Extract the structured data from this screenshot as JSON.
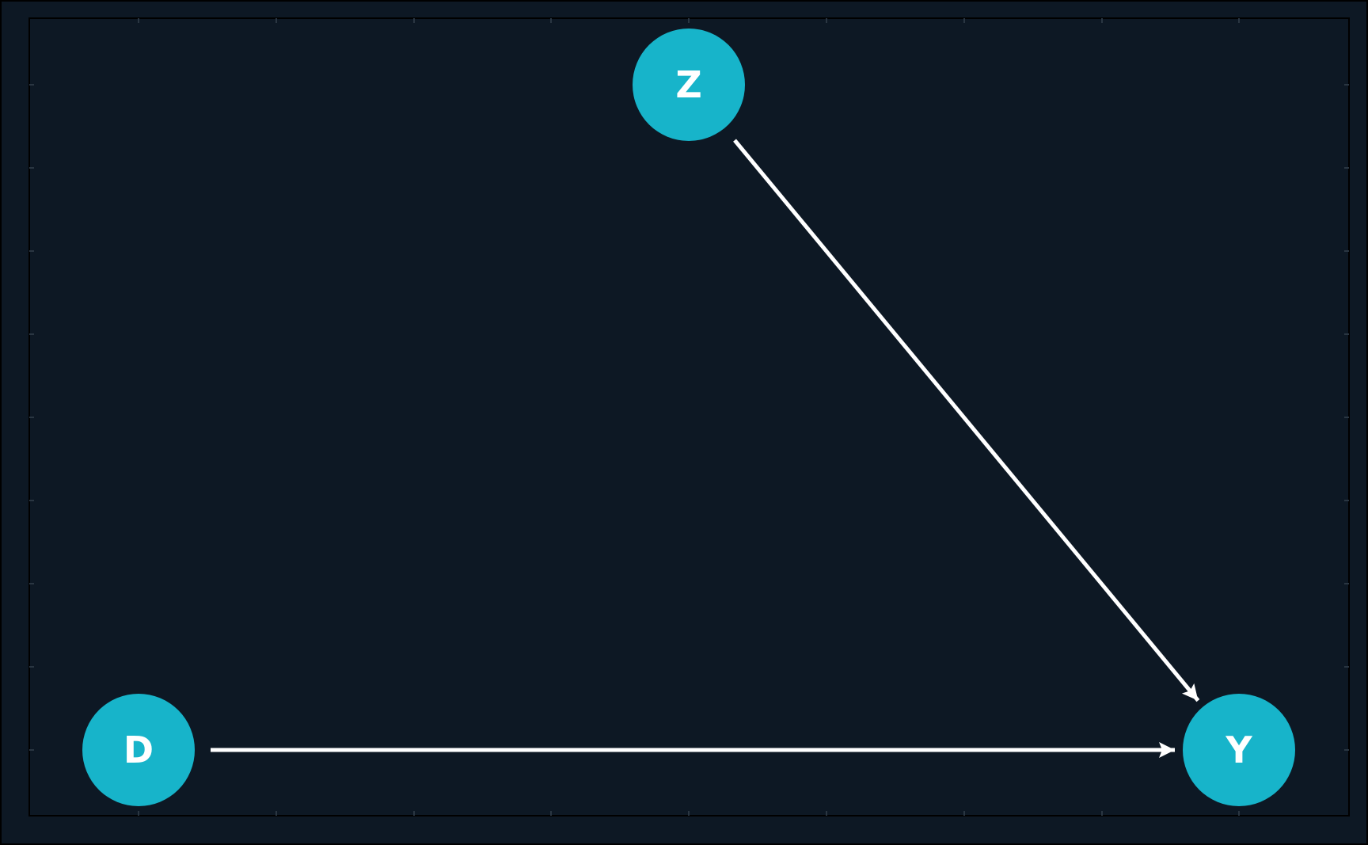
{
  "colors": {
    "background": "#0d1824",
    "node_fill": "#17b4ca",
    "edge": "#ffffff",
    "frame": "#000000",
    "label": "#ffffff"
  },
  "nodes": [
    {
      "id": "Z",
      "label": "Z"
    },
    {
      "id": "D",
      "label": "D"
    },
    {
      "id": "Y",
      "label": "Y"
    }
  ],
  "edges": [
    {
      "from": "Z",
      "to": "Y"
    },
    {
      "from": "D",
      "to": "Y"
    }
  ]
}
